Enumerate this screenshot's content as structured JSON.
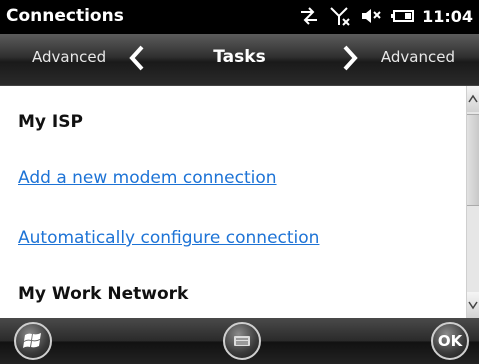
{
  "status": {
    "app_title": "Connections",
    "time": "11:04",
    "icons": [
      "connectivity-icon",
      "no-signal-icon",
      "volume-muted-icon",
      "battery-icon"
    ]
  },
  "tabs": {
    "left_label": "Advanced",
    "center_label": "Tasks",
    "right_label": "Advanced"
  },
  "content": {
    "sections": [
      {
        "title": "My ISP",
        "links": [
          "Add a new modem connection",
          "Automatically configure connection"
        ]
      },
      {
        "title": "My Work Network"
      }
    ]
  },
  "bottombar": {
    "ok_label": "OK",
    "start_icon": "windows-start-icon",
    "keyboard_icon": "keyboard-icon"
  },
  "colors": {
    "link": "#1d73d6",
    "background": "#ffffff",
    "bar": "#000000"
  }
}
